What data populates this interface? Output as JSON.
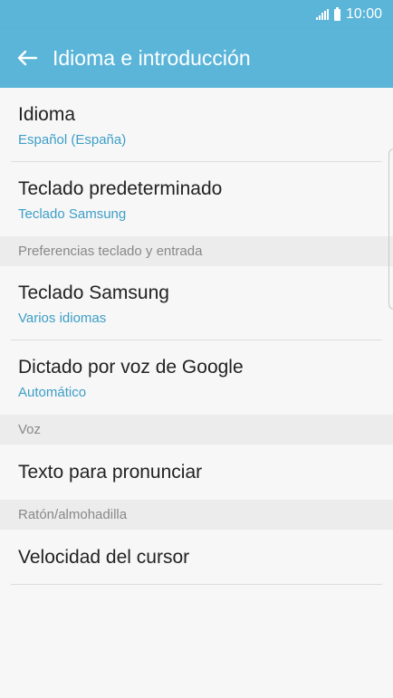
{
  "status_bar": {
    "time": "10:00",
    "icons": [
      "signal-icon",
      "battery-icon"
    ]
  },
  "app_bar": {
    "title": "Idioma e introducción",
    "back_icon": "back-arrow-icon",
    "color": "#5ab5d9"
  },
  "list": {
    "idioma": {
      "label": "Idioma",
      "value": "Español (España)"
    },
    "teclado_pred": {
      "label": "Teclado predeterminado",
      "value": "Teclado Samsung"
    },
    "section_prefs": "Preferencias teclado y entrada",
    "teclado_samsung": {
      "label": "Teclado Samsung",
      "value": "Varios idiomas"
    },
    "dictado": {
      "label": "Dictado por voz de Google",
      "value": "Automático"
    },
    "section_voz": "Voz",
    "texto": {
      "label": "Texto para pronunciar"
    },
    "section_raton": "Ratón/almohadilla",
    "cursor": {
      "label": "Velocidad del cursor"
    }
  },
  "colors": {
    "accent": "#3d9ec7",
    "background": "#f7f7f7",
    "section_background": "#ececec"
  }
}
